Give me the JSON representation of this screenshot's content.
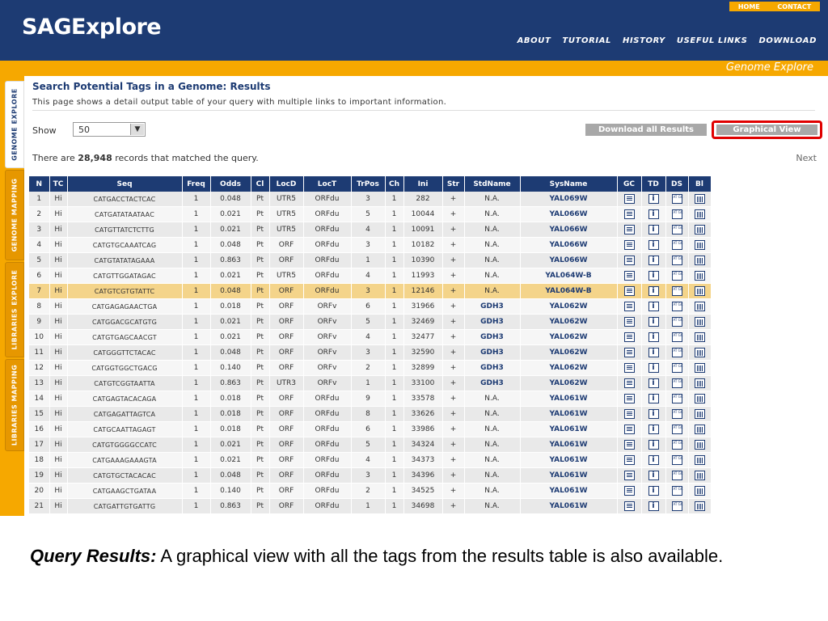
{
  "header": {
    "logo": "SAGExplore",
    "top_links": [
      "HOME",
      "CONTACT"
    ],
    "nav": [
      "ABOUT",
      "TUTORIAL",
      "HISTORY",
      "USEFUL LINKS",
      "DOWNLOAD"
    ],
    "section": "Genome Explore"
  },
  "side_tabs": [
    "GENOME EXPLORE",
    "GENOME MAPPING",
    "LIBRARIES EXPLORE",
    "LIBRARIES MAPPING"
  ],
  "page": {
    "title": "Search Potential Tags in a Genome: Results",
    "description": "This page shows a detail output table of your query with multiple links to important information.",
    "show_label": "Show",
    "show_value": "50",
    "download_button": "Download all Results",
    "graphical_button": "Graphical View",
    "count_prefix": "There are ",
    "count_value": "28,948",
    "count_suffix": " records that matched the query.",
    "next": "Next"
  },
  "table": {
    "columns": [
      "N",
      "TC",
      "Seq",
      "Freq",
      "Odds",
      "Cl",
      "LocD",
      "LocT",
      "TrPos",
      "Ch",
      "Ini",
      "Str",
      "StdName",
      "SysName",
      "GC",
      "TD",
      "DS",
      "Bl"
    ],
    "highlight_row": 7,
    "rows": [
      [
        "1",
        "Hi",
        "CATGACCTACTCAC",
        "1",
        "0.048",
        "Pt",
        "UTR5",
        "ORFdu",
        "3",
        "1",
        "282",
        "+",
        "N.A.",
        "YAL069W"
      ],
      [
        "2",
        "Hi",
        "CATGATATAATAAC",
        "1",
        "0.021",
        "Pt",
        "UTR5",
        "ORFdu",
        "5",
        "1",
        "10044",
        "+",
        "N.A.",
        "YAL066W"
      ],
      [
        "3",
        "Hi",
        "CATGTTATCTCTTG",
        "1",
        "0.021",
        "Pt",
        "UTR5",
        "ORFdu",
        "4",
        "1",
        "10091",
        "+",
        "N.A.",
        "YAL066W"
      ],
      [
        "4",
        "Hi",
        "CATGTGCAAATCAG",
        "1",
        "0.048",
        "Pt",
        "ORF",
        "ORFdu",
        "3",
        "1",
        "10182",
        "+",
        "N.A.",
        "YAL066W"
      ],
      [
        "5",
        "Hi",
        "CATGTATATAGAAA",
        "1",
        "0.863",
        "Pt",
        "ORF",
        "ORFdu",
        "1",
        "1",
        "10390",
        "+",
        "N.A.",
        "YAL066W"
      ],
      [
        "6",
        "Hi",
        "CATGTTGGATAGAC",
        "1",
        "0.021",
        "Pt",
        "UTR5",
        "ORFdu",
        "4",
        "1",
        "11993",
        "+",
        "N.A.",
        "YAL064W-B"
      ],
      [
        "7",
        "Hi",
        "CATGTCGTGTATTC",
        "1",
        "0.048",
        "Pt",
        "ORF",
        "ORFdu",
        "3",
        "1",
        "12146",
        "+",
        "N.A.",
        "YAL064W-B"
      ],
      [
        "8",
        "Hi",
        "CATGAGAGAACTGA",
        "1",
        "0.018",
        "Pt",
        "ORF",
        "ORFv",
        "6",
        "1",
        "31966",
        "+",
        "GDH3",
        "YAL062W"
      ],
      [
        "9",
        "Hi",
        "CATGGACGCATGTG",
        "1",
        "0.021",
        "Pt",
        "ORF",
        "ORFv",
        "5",
        "1",
        "32469",
        "+",
        "GDH3",
        "YAL062W"
      ],
      [
        "10",
        "Hi",
        "CATGTGAGCAACGT",
        "1",
        "0.021",
        "Pt",
        "ORF",
        "ORFv",
        "4",
        "1",
        "32477",
        "+",
        "GDH3",
        "YAL062W"
      ],
      [
        "11",
        "Hi",
        "CATGGGTTCTACAC",
        "1",
        "0.048",
        "Pt",
        "ORF",
        "ORFv",
        "3",
        "1",
        "32590",
        "+",
        "GDH3",
        "YAL062W"
      ],
      [
        "12",
        "Hi",
        "CATGGTGGCTGACG",
        "1",
        "0.140",
        "Pt",
        "ORF",
        "ORFv",
        "2",
        "1",
        "32899",
        "+",
        "GDH3",
        "YAL062W"
      ],
      [
        "13",
        "Hi",
        "CATGTCGGTAATTA",
        "1",
        "0.863",
        "Pt",
        "UTR3",
        "ORFv",
        "1",
        "1",
        "33100",
        "+",
        "GDH3",
        "YAL062W"
      ],
      [
        "14",
        "Hi",
        "CATGAGTACACAGA",
        "1",
        "0.018",
        "Pt",
        "ORF",
        "ORFdu",
        "9",
        "1",
        "33578",
        "+",
        "N.A.",
        "YAL061W"
      ],
      [
        "15",
        "Hi",
        "CATGAGATTAGTCA",
        "1",
        "0.018",
        "Pt",
        "ORF",
        "ORFdu",
        "8",
        "1",
        "33626",
        "+",
        "N.A.",
        "YAL061W"
      ],
      [
        "16",
        "Hi",
        "CATGCAATTAGAGT",
        "1",
        "0.018",
        "Pt",
        "ORF",
        "ORFdu",
        "6",
        "1",
        "33986",
        "+",
        "N.A.",
        "YAL061W"
      ],
      [
        "17",
        "Hi",
        "CATGTGGGGCCATC",
        "1",
        "0.021",
        "Pt",
        "ORF",
        "ORFdu",
        "5",
        "1",
        "34324",
        "+",
        "N.A.",
        "YAL061W"
      ],
      [
        "18",
        "Hi",
        "CATGAAAGAAAGTA",
        "1",
        "0.021",
        "Pt",
        "ORF",
        "ORFdu",
        "4",
        "1",
        "34373",
        "+",
        "N.A.",
        "YAL061W"
      ],
      [
        "19",
        "Hi",
        "CATGTGCTACACAC",
        "1",
        "0.048",
        "Pt",
        "ORF",
        "ORFdu",
        "3",
        "1",
        "34396",
        "+",
        "N.A.",
        "YAL061W"
      ],
      [
        "20",
        "Hi",
        "CATGAAGCTGATAA",
        "1",
        "0.140",
        "Pt",
        "ORF",
        "ORFdu",
        "2",
        "1",
        "34525",
        "+",
        "N.A.",
        "YAL061W"
      ],
      [
        "21",
        "Hi",
        "CATGATTGTGATTG",
        "1",
        "0.863",
        "Pt",
        "ORF",
        "ORFdu",
        "1",
        "1",
        "34698",
        "+",
        "N.A.",
        "YAL061W"
      ]
    ]
  },
  "caption": {
    "bold": "Query Results:",
    "text": " A graphical view with all the tags from the results table is also available."
  },
  "colors": {
    "header_blue": "#1d3b73",
    "accent_orange": "#f6a800",
    "highlight_row": "#f4d48a",
    "graphical_outline": "#e00000"
  }
}
